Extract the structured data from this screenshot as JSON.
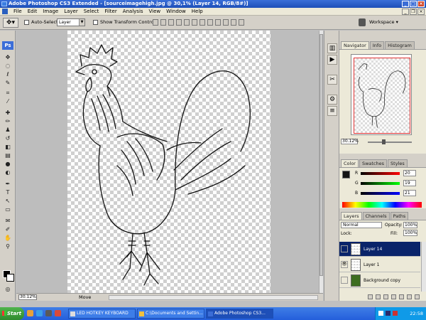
{
  "titlebar": {
    "title": "Adobe Photoshop CS3 Extended - [sourceimagehigh.jpg @ 30,1% (Layer 14, RGB/8#)]"
  },
  "menu": [
    "File",
    "Edit",
    "Image",
    "Layer",
    "Select",
    "Filter",
    "Analysis",
    "View",
    "Window",
    "Help"
  ],
  "options": {
    "auto_select": "Auto-Select:",
    "layer_value": "Layer",
    "show_transform": "Show Transform Controls",
    "workspace": "Workspace ▾"
  },
  "canvas": {
    "zoom": "30.12%",
    "status": "Move"
  },
  "navigator": {
    "tabs": [
      "Navigator",
      "Info",
      "Histogram"
    ],
    "zoom": "30.12%"
  },
  "color": {
    "tabs": [
      "Color",
      "Swatches",
      "Styles"
    ],
    "r": "20",
    "g": "19",
    "b": "21",
    "fg_color": "#141315"
  },
  "layers": {
    "tabs": [
      "Layers",
      "Channels",
      "Paths"
    ],
    "blend": "Normal",
    "opacity_label": "Opacity:",
    "opacity": "100%",
    "lock_label": "Lock:",
    "fill_label": "Fill:",
    "fill": "100%",
    "items": [
      {
        "name": "Layer 14"
      },
      {
        "name": "Layer 1"
      },
      {
        "name": "Background copy"
      }
    ]
  },
  "taskbar": {
    "start": "Start",
    "tasks": [
      "LED HOTKEY KEYBOARD",
      "C:\\Documents and Settin...",
      "Adobe Photoshop CS3..."
    ],
    "clock": "22:58"
  }
}
